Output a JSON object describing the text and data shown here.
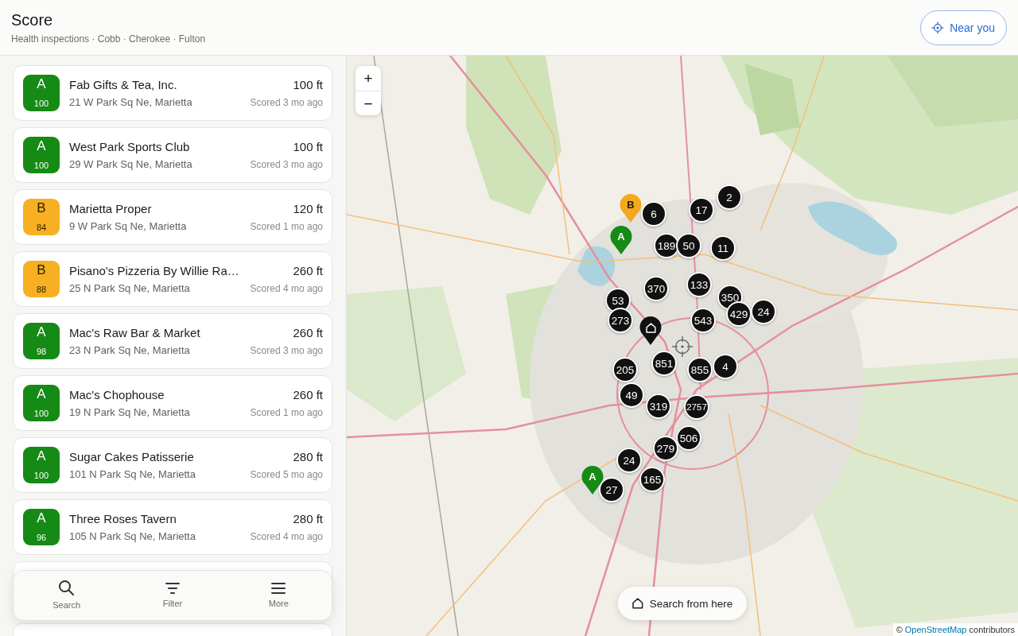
{
  "header": {
    "title": "Score",
    "subtitle": "Health inspections · Cobb · Cherokee · Fulton",
    "near_button": {
      "label": "Near you"
    }
  },
  "results": [
    {
      "grade": "A",
      "score": "100",
      "color": "#158a15",
      "name": "Fab Gifts & Tea, Inc.",
      "address": "21 W Park Sq Ne, Marietta",
      "distance": "100 ft",
      "scored": "Scored 3 mo ago"
    },
    {
      "grade": "A",
      "score": "100",
      "color": "#158a15",
      "name": "West Park Sports Club",
      "address": "29 W Park Sq Ne, Marietta",
      "distance": "100 ft",
      "scored": "Scored 3 mo ago"
    },
    {
      "grade": "B",
      "score": "84",
      "color": "#f6b021",
      "name": "Marietta Proper",
      "address": "9 W Park Sq Ne, Marietta",
      "distance": "120 ft",
      "scored": "Scored 1 mo ago"
    },
    {
      "grade": "B",
      "score": "88",
      "color": "#f6b021",
      "name": "Pisano's Pizzeria By Willie Ra…",
      "address": "25 N Park Sq Ne, Marietta",
      "distance": "260 ft",
      "scored": "Scored 4 mo ago"
    },
    {
      "grade": "A",
      "score": "98",
      "color": "#158a15",
      "name": "Mac's Raw Bar & Market",
      "address": "23 N Park Sq Ne, Marietta",
      "distance": "260 ft",
      "scored": "Scored 3 mo ago"
    },
    {
      "grade": "A",
      "score": "100",
      "color": "#158a15",
      "name": "Mac's Chophouse",
      "address": "19 N Park Sq Ne, Marietta",
      "distance": "260 ft",
      "scored": "Scored 1 mo ago"
    },
    {
      "grade": "A",
      "score": "100",
      "color": "#158a15",
      "name": "Sugar Cakes Patisserie",
      "address": "101 N Park Sq Ne, Marietta",
      "distance": "280 ft",
      "scored": "Scored 5 mo ago"
    },
    {
      "grade": "A",
      "score": "96",
      "color": "#158a15",
      "name": "Three Roses Tavern",
      "address": "105 N Park Sq Ne, Marietta",
      "distance": "280 ft",
      "scored": "Scored 4 mo ago"
    }
  ],
  "bottom_nav": [
    {
      "kind": "search",
      "label": "Search"
    },
    {
      "kind": "filter",
      "label": "Filter"
    },
    {
      "kind": "more",
      "label": "More"
    }
  ],
  "map": {
    "zoom": {
      "in": "+",
      "out": "−"
    },
    "markers": [
      {
        "kind": "pin",
        "label": "B",
        "color": "#f3a81e"
      },
      {
        "kind": "cluster",
        "label": "2"
      },
      {
        "kind": "cluster",
        "label": "17"
      },
      {
        "kind": "cluster",
        "label": "6"
      },
      {
        "kind": "pin",
        "label": "A",
        "color": "#158a15"
      },
      {
        "kind": "cluster",
        "label": "189"
      },
      {
        "kind": "cluster",
        "label": "50"
      },
      {
        "kind": "cluster",
        "label": "11"
      },
      {
        "kind": "cluster",
        "label": "133"
      },
      {
        "kind": "cluster",
        "label": "370"
      },
      {
        "kind": "cluster",
        "label": "350"
      },
      {
        "kind": "cluster",
        "label": "53"
      },
      {
        "kind": "cluster",
        "label": "429"
      },
      {
        "kind": "cluster",
        "label": "24"
      },
      {
        "kind": "cluster",
        "label": "543"
      },
      {
        "kind": "cluster",
        "label": "273"
      },
      {
        "kind": "home"
      },
      {
        "kind": "cluster",
        "label": "851"
      },
      {
        "kind": "cluster",
        "label": "4"
      },
      {
        "kind": "cluster",
        "label": "205"
      },
      {
        "kind": "cluster",
        "label": "855"
      },
      {
        "kind": "cluster",
        "label": "49"
      },
      {
        "kind": "cluster",
        "label": "319"
      },
      {
        "kind": "cluster",
        "label": "2757"
      },
      {
        "kind": "cluster",
        "label": "506"
      },
      {
        "kind": "cluster",
        "label": "279"
      },
      {
        "kind": "cluster",
        "label": "24"
      },
      {
        "kind": "pin",
        "label": "A",
        "color": "#158a15"
      },
      {
        "kind": "cluster",
        "label": "165"
      },
      {
        "kind": "cluster",
        "label": "27"
      }
    ],
    "search_button": {
      "label": "Search from here"
    },
    "attribution": {
      "prefix": "©",
      "link": "OpenStreetMap",
      "suffix": "contributors"
    }
  }
}
